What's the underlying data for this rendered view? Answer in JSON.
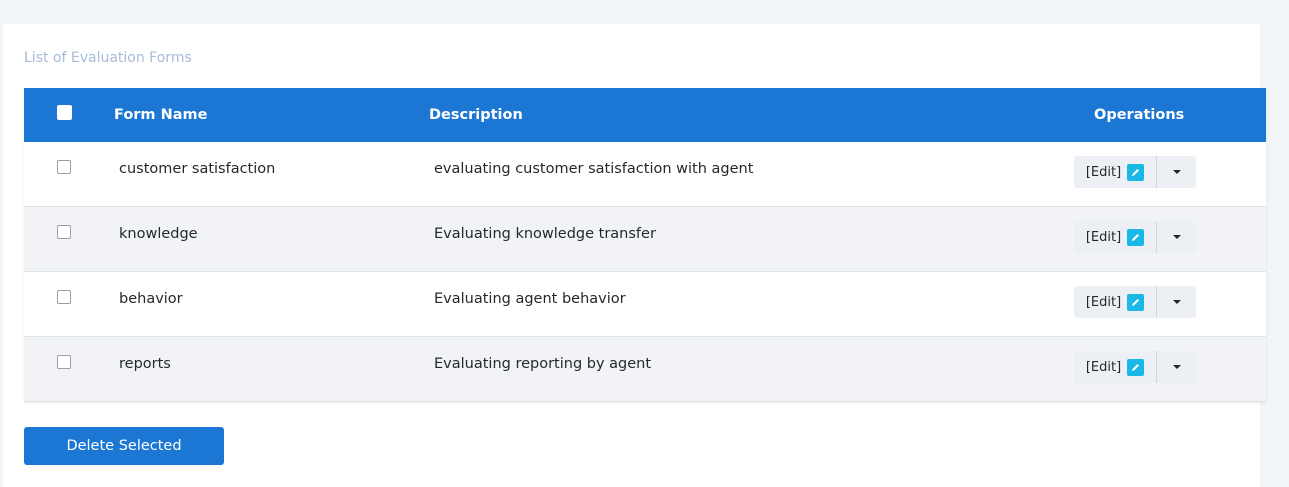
{
  "card": {
    "title": "List of Evaluation Forms"
  },
  "table": {
    "headers": {
      "form_name": "Form Name",
      "description": "Description",
      "operations": "Operations"
    },
    "rows": [
      {
        "name": "customer satisfaction",
        "description": "evaluating customer satisfaction with agent",
        "edit_label": "[Edit]"
      },
      {
        "name": "knowledge",
        "description": "Evaluating knowledge transfer",
        "edit_label": "[Edit]"
      },
      {
        "name": "behavior",
        "description": "Evaluating agent behavior",
        "edit_label": "[Edit]"
      },
      {
        "name": "reports",
        "description": "Evaluating reporting by agent",
        "edit_label": "[Edit]"
      }
    ]
  },
  "actions": {
    "delete_selected": "Delete Selected"
  },
  "colors": {
    "header_bg": "#1b77d3",
    "edit_icon": "#1ab8e6",
    "title": "#a7bbd8"
  },
  "icons": {
    "edit": "pencil-icon",
    "dropdown": "caret-down-icon"
  }
}
